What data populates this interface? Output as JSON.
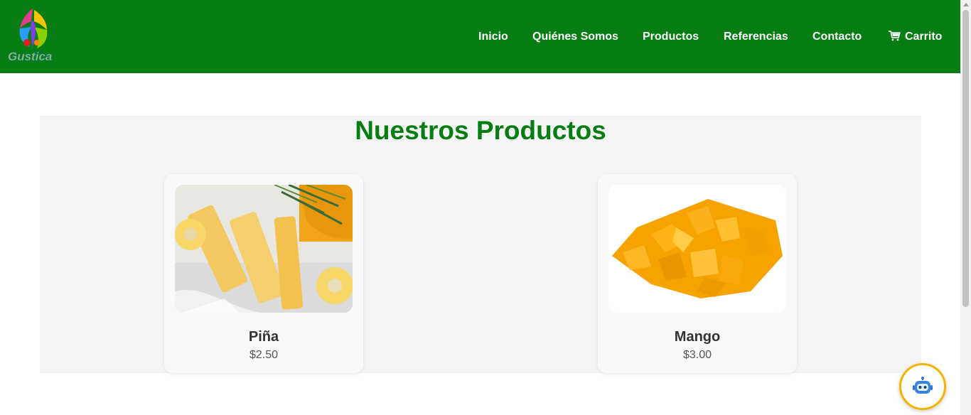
{
  "brand": {
    "logo_text": "Gustica"
  },
  "nav": {
    "items": [
      {
        "label": "Inicio"
      },
      {
        "label": "Quiénes Somos"
      },
      {
        "label": "Productos"
      },
      {
        "label": "Referencias"
      },
      {
        "label": "Contacto"
      },
      {
        "label": "Carrito",
        "icon": "cart-icon"
      }
    ]
  },
  "products": {
    "title": "Nuestros Productos",
    "items": [
      {
        "name": "Piña",
        "price": "$2.50"
      },
      {
        "name": "Mango",
        "price": "$3.00"
      }
    ]
  },
  "chatbot": {
    "icon": "robot-icon"
  },
  "colors": {
    "header_bg": "#077d14",
    "title": "#077d14",
    "chatbot_border": "#f5b400"
  }
}
